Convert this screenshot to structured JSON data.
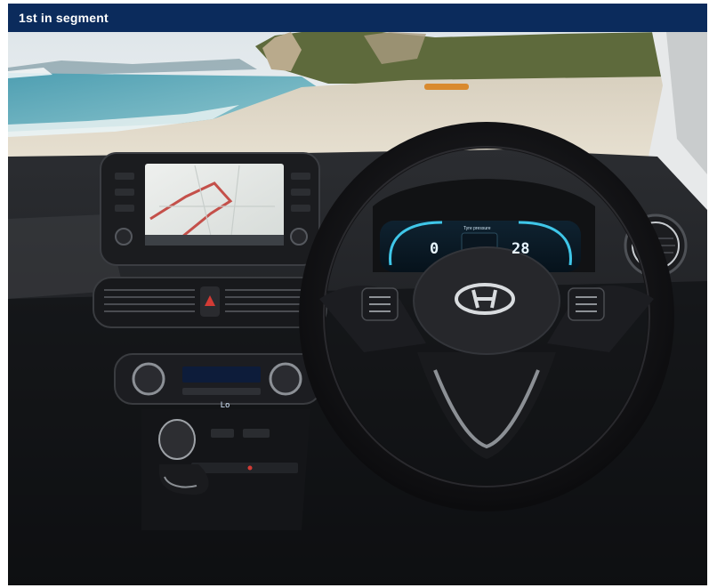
{
  "banner": {
    "label": "1st  in segment",
    "background_color": "#0b2b5c",
    "text_color": "#ffffff"
  },
  "photo": {
    "brand_logo": "hyundai-logo-icon",
    "cluster": {
      "title": "Tyre pressure",
      "left_readout": "0",
      "right_readout": "28"
    },
    "climate_display": "Lo"
  }
}
